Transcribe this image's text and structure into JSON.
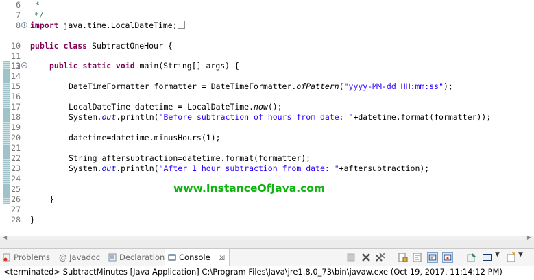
{
  "editor": {
    "lines": [
      {
        "n": "6",
        "t": "*"
      },
      {
        "n": "7",
        "t": "*/"
      },
      {
        "n": "8",
        "a": "import",
        "b": " java.time.LocalDateTime;"
      },
      {
        "n": "10",
        "a": "public class",
        "b": " SubtractOneHour {"
      },
      {
        "n": "13",
        "a": "public static void",
        "b": " main(String[] args) {"
      },
      {
        "n": "15",
        "a": "DateTimeFormatter formatter = DateTimeFormatter.",
        "i": "ofPattern",
        "b": "(",
        "s": "\"yyyy-MM-dd HH:mm:ss\"",
        "c": ");"
      },
      {
        "n": "17",
        "a": "LocalDateTime datetime = LocalDateTime.",
        "i": "now",
        "b": "();"
      },
      {
        "n": "18",
        "a": "System.",
        "f": "out",
        "b": ".println(",
        "s": "\"Before subtraction of hours from date: \"",
        "c": "+datetime.format(formatter));"
      },
      {
        "n": "20",
        "t": "datetime=datetime.minusHours(1);"
      },
      {
        "n": "22",
        "t": "String aftersubtraction=datetime.format(formatter);"
      },
      {
        "n": "23",
        "a": "System.",
        "f": "out",
        "b": ".println(",
        "s": "\"After 1 hour subtraction from date: \"",
        "c": "+aftersubtraction);"
      },
      {
        "n": "26",
        "t": "}"
      },
      {
        "n": "28",
        "t": "}"
      }
    ],
    "line_numbers": [
      "6",
      "7",
      "8",
      "10",
      "11",
      "12",
      "13",
      "14",
      "15",
      "16",
      "17",
      "18",
      "19",
      "20",
      "21",
      "22",
      "23",
      "24",
      "25",
      "26",
      "27",
      "28"
    ],
    "fold_expand_icon": "plus",
    "fold_collapse_icon": "minus"
  },
  "watermark": "www.InstanceOfJava.com",
  "panel": {
    "tabs": [
      {
        "label": "Problems",
        "icon": "problems-icon"
      },
      {
        "label": "@ Javadoc",
        "icon": ""
      },
      {
        "label": "Declaration",
        "icon": "declaration-icon"
      },
      {
        "label": "Console",
        "icon": "console-icon",
        "close": "☒"
      }
    ]
  },
  "status": "<terminated> SubtractMinutes [Java Application] C:\\Program Files\\Java\\jre1.8.0_73\\bin\\javaw.exe (Oct 19, 2017, 11:14:12 PM)",
  "colors": {
    "keyword": "#7f0055",
    "string": "#2a00ff",
    "comment": "#3f7f5f",
    "field": "#0000c0",
    "watermark": "#0fb30f"
  }
}
